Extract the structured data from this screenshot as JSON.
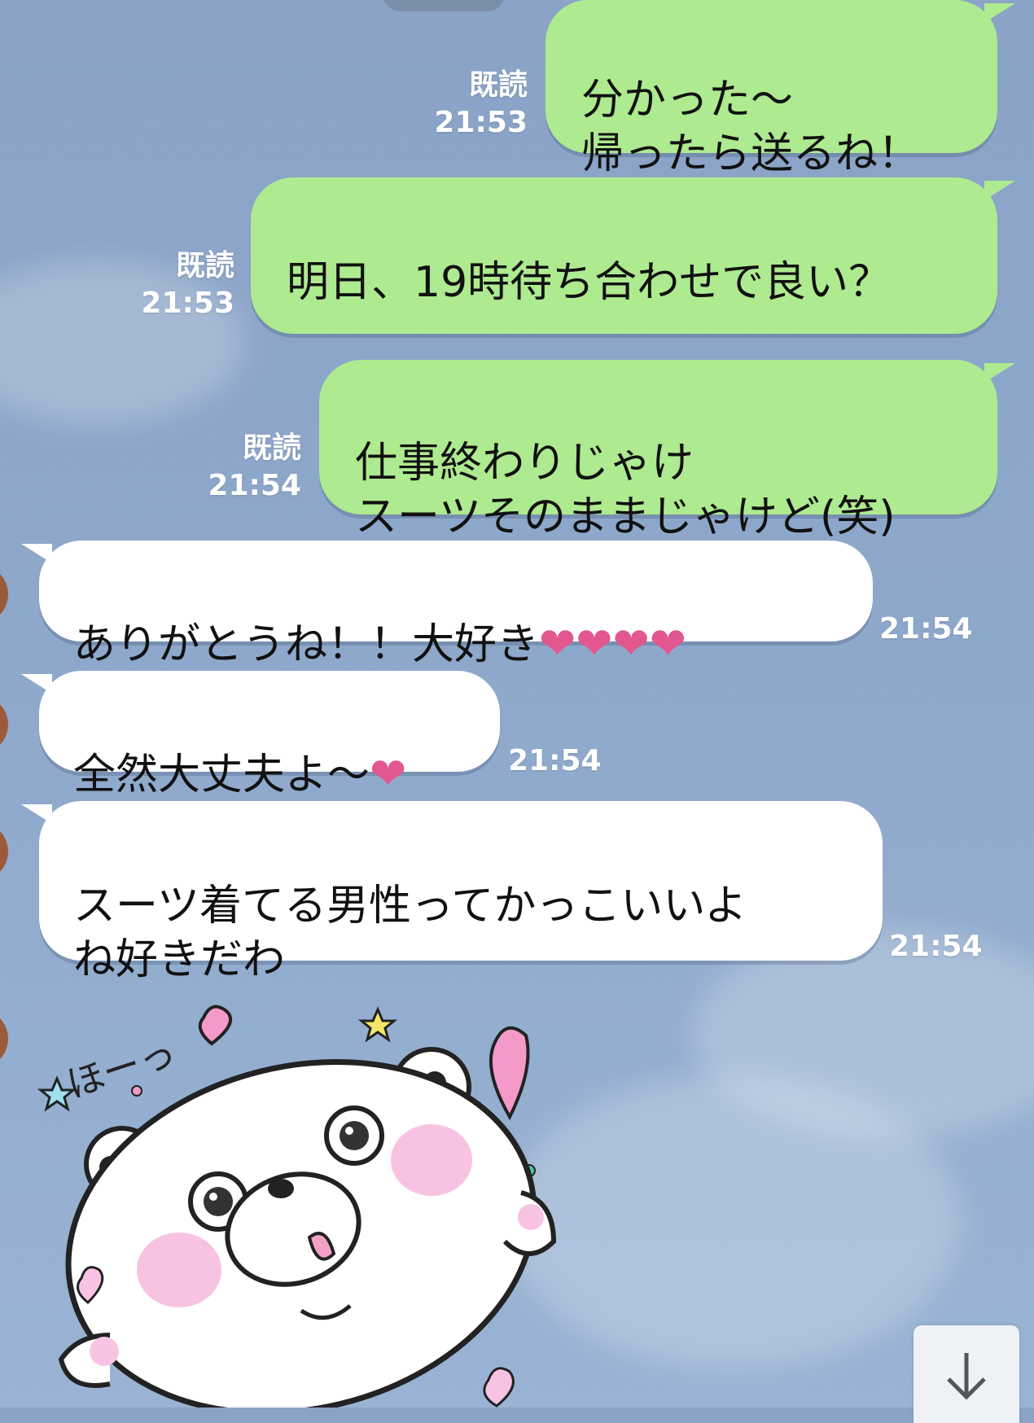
{
  "messages": [
    {
      "side": "out",
      "text": "分かった〜\n帰ったら送るね！",
      "status": "既読",
      "time": "21:53"
    },
    {
      "side": "out",
      "text": "明日、19時待ち合わせで良い？",
      "status": "既読",
      "time": "21:53"
    },
    {
      "side": "out",
      "text": "仕事終わりじゃけ\nスーツそのままじゃけど(笑)",
      "status": "既読",
      "time": "21:54"
    },
    {
      "side": "in",
      "text": "ありがとうね！！大好き",
      "hearts": "❤❤❤❤",
      "time": "21:54"
    },
    {
      "side": "in",
      "text": "全然大丈夫よ〜",
      "hearts": "❤",
      "time": "21:54"
    },
    {
      "side": "in",
      "text": "スーツ着てる男性ってかっこいいよ\nね好きだわ",
      "time": "21:54"
    }
  ],
  "sticker": {
    "name": "white-bear-sticker",
    "caption": "ほーっ"
  },
  "colors": {
    "outgoing_bubble": "#aeea8f",
    "incoming_bubble": "#ffffff",
    "background": "#8aa3c6",
    "heart": "#e2578f"
  },
  "scroll_button": {
    "icon": "arrow-down-icon"
  }
}
